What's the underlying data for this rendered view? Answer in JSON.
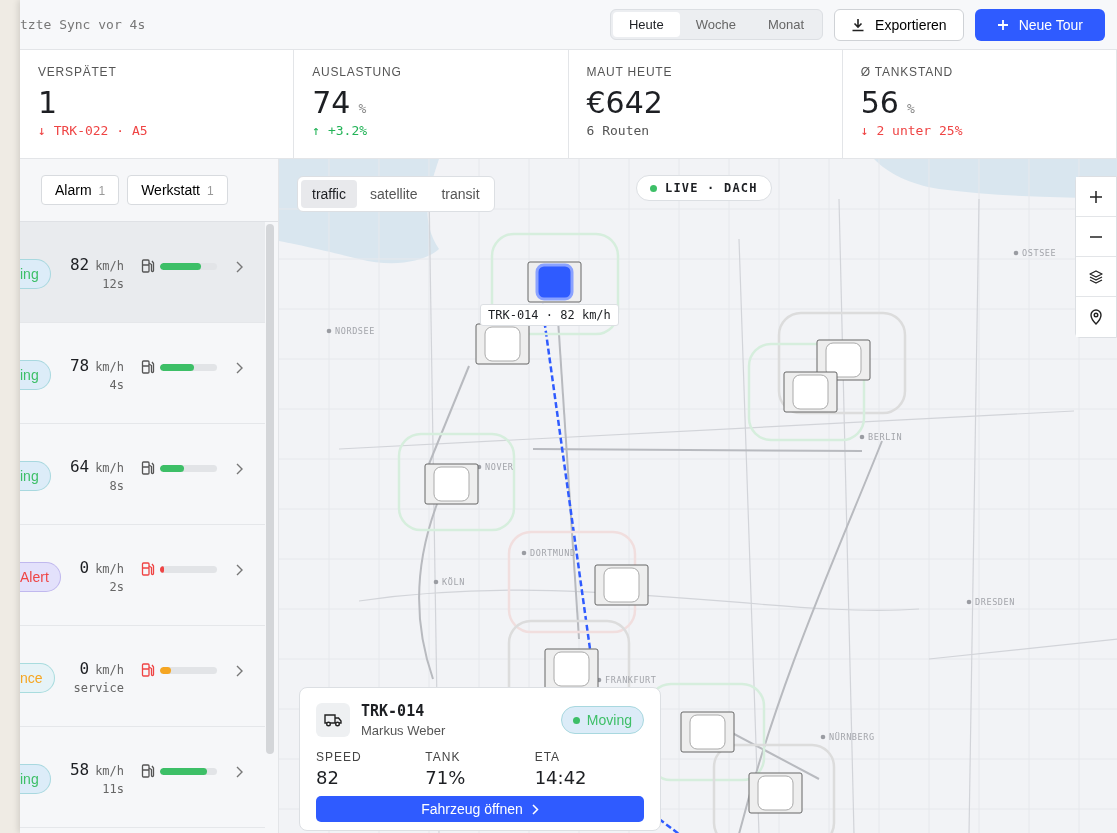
{
  "header": {
    "sync_text": "tzte Sync vor 4s",
    "range_tabs": [
      {
        "label": "Heute",
        "selected": true
      },
      {
        "label": "Woche",
        "selected": false
      },
      {
        "label": "Monat",
        "selected": false
      }
    ],
    "export_button": "Exportieren",
    "new_button": "Neue Tour"
  },
  "kpis": [
    {
      "label": "VERSPÄTET",
      "value": "1",
      "delta": "↓ TRK-022 · A5",
      "color": "#ef4444"
    },
    {
      "label": "AUSLASTUNG",
      "value": "74",
      "unit": "%",
      "delta": "↑ +3.2%",
      "color": "#22b357"
    },
    {
      "label": "MAUT HEUTE",
      "value": "€642",
      "delta": "6 Routen",
      "color": "#555555"
    },
    {
      "label": "Ø TANKSTAND",
      "value": "56",
      "unit": "%",
      "delta": "↓ 2 unter 25%",
      "color": "#ef4444"
    }
  ],
  "filters": [
    {
      "label": "Alarm",
      "count": "1"
    },
    {
      "label": "Werkstatt",
      "count": "1"
    }
  ],
  "vehicles": [
    {
      "status": "ing",
      "kind": "moving",
      "speed": "82",
      "unit": "km/h",
      "age": "12s",
      "level": 0.72,
      "selected": true
    },
    {
      "status": "ing",
      "kind": "moving",
      "speed": "78",
      "unit": "km/h",
      "age": "4s",
      "level": 0.6,
      "selected": false
    },
    {
      "status": "ing",
      "kind": "moving",
      "speed": "64",
      "unit": "km/h",
      "age": "8s",
      "level": 0.42,
      "selected": false
    },
    {
      "status": "Alert",
      "kind": "alert",
      "speed": "0",
      "unit": "km/h",
      "age": "2s",
      "level": 0.07,
      "selected": false
    },
    {
      "status": "nce",
      "kind": "service",
      "speed": "0",
      "unit": "km/h",
      "age": "service",
      "level": 0.2,
      "selected": false
    },
    {
      "status": "ing",
      "kind": "moving",
      "speed": "58",
      "unit": "km/h",
      "age": "11s",
      "level": 0.82,
      "selected": false
    }
  ],
  "map": {
    "layers": [
      {
        "label": "traffic",
        "selected": true
      },
      {
        "label": "satellite",
        "selected": false
      },
      {
        "label": "transit",
        "selected": false
      }
    ],
    "live_label": "LIVE · DACH",
    "cities": [
      "NORDSEE",
      "OSTSEE",
      "BERLIN",
      "NOVER",
      "DORTMUND",
      "KÖLN",
      "DRESDEN",
      "FRANKFURT",
      "NÜRNBERG"
    ],
    "tooltip": "TRK-014 · 82 km/h",
    "markers": [
      {
        "selected": true
      },
      {
        "selected": false
      },
      {
        "selected": false
      },
      {
        "selected": false
      },
      {
        "selected": false
      },
      {
        "selected": false
      },
      {
        "selected": false
      },
      {
        "selected": false
      },
      {
        "selected": false
      }
    ]
  },
  "popup": {
    "title": "TRK-014",
    "driver": "Markus Weber",
    "status": "Moving",
    "stats": [
      {
        "label": "SPEED",
        "value": "82"
      },
      {
        "label": "TANK",
        "value": "71%"
      },
      {
        "label": "ETA",
        "value": "14:42"
      }
    ],
    "button": "Fahrzeug öffnen"
  }
}
